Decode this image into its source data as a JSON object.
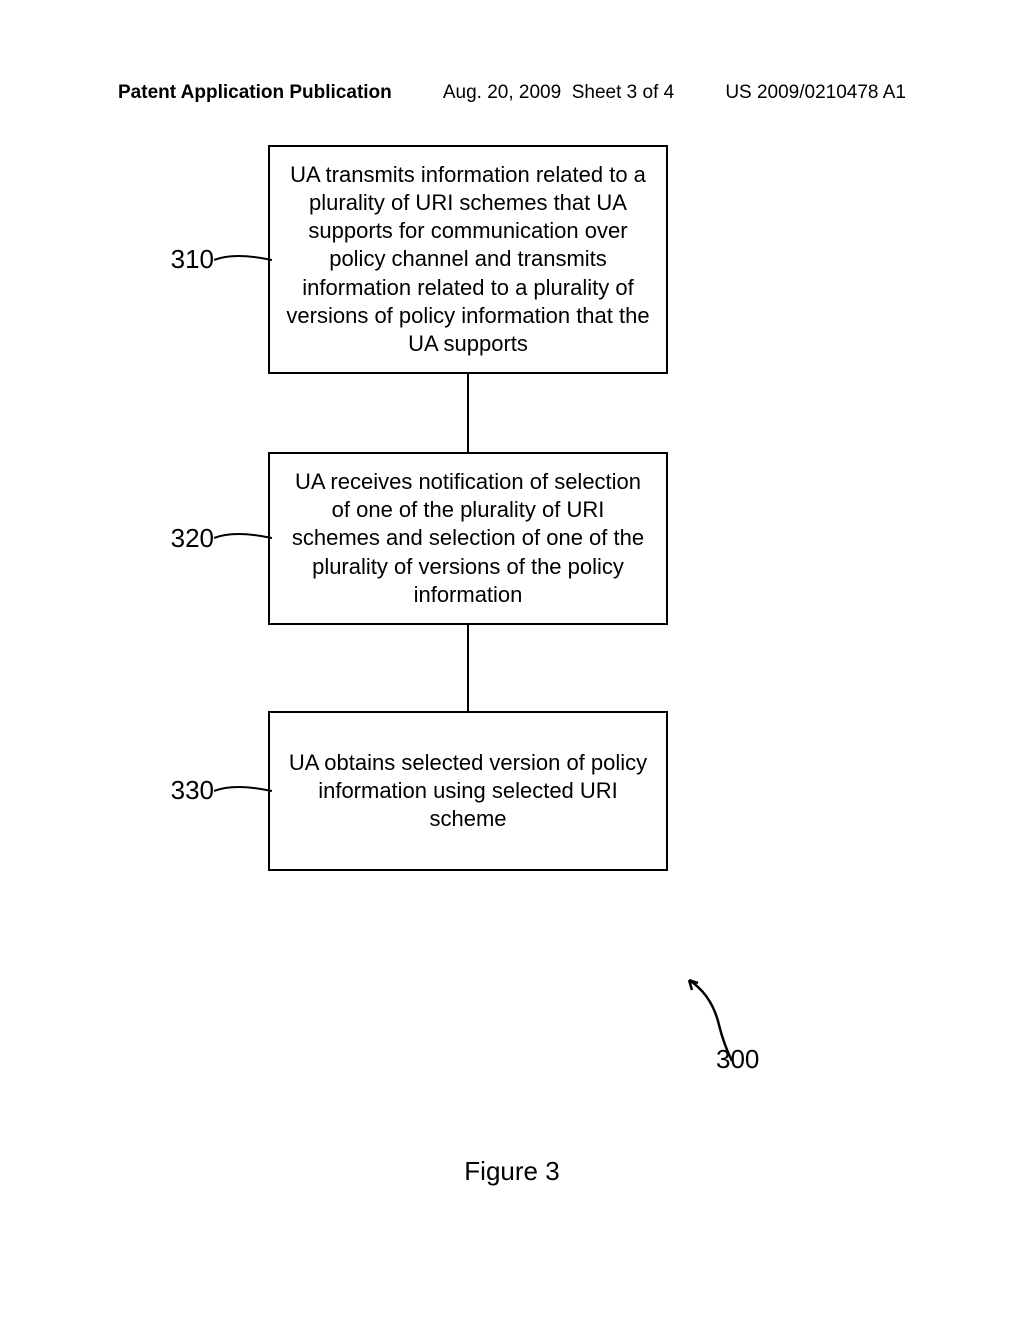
{
  "header": {
    "left": "Patent Application Publication",
    "center_date": "Aug. 20, 2009",
    "center_sheet": "Sheet 3 of 4",
    "right": "US 2009/0210478 A1"
  },
  "flow": {
    "steps": [
      {
        "ref": "310",
        "text": "UA transmits information related to a plurality of URI schemes that UA supports for communication over policy channel and transmits information related to a plurality of versions of policy information that the UA supports"
      },
      {
        "ref": "320",
        "text": "UA receives notification of selection of one of the plurality of URI schemes and selection of one of the plurality of versions of the policy information"
      },
      {
        "ref": "330",
        "text": "UA obtains selected version of policy information using selected URI scheme"
      }
    ],
    "diagram_ref": "300"
  },
  "caption": "Figure 3"
}
